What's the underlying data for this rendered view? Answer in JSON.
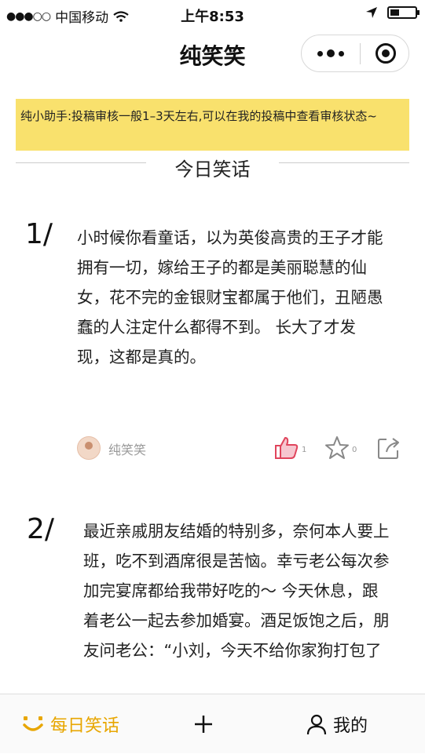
{
  "status_bar": {
    "carrier": "中国移动",
    "time": "上午8:53"
  },
  "nav": {
    "title": "纯笑笑"
  },
  "notice": {
    "text": "纯小助手:投稿审核一般1–3天左右,可以在我的投稿中查看审核状态~"
  },
  "section": {
    "title": "今日笑话"
  },
  "posts": [
    {
      "number": "1/",
      "text": "小时候你看童话，以为英俊高贵的王子才能拥有一切，嫁给王子的都是美丽聪慧的仙女，花不完的金银财宝都属于他们，丑陋愚蠢的人注定什么都得不到。 长大了才发现，这都是真的。",
      "author": "纯笑笑",
      "likes": "1",
      "favorites": "0"
    },
    {
      "number": "2/",
      "text": "最近亲戚朋友结婚的特别多，奈何本人要上班，吃不到酒席很是苦恼。幸亏老公每次参加完宴席都给我带好吃的～ 今天休息，跟着老公一起去参加婚宴。酒足饭饱之后，朋友问老公：“小刘，今天不给你家狗打包了"
    }
  ],
  "tabbar": {
    "items": [
      {
        "label": "每日笑话",
        "icon": "smile-icon",
        "active": true
      },
      {
        "label": "",
        "icon": "plus-icon",
        "active": false
      },
      {
        "label": "我的",
        "icon": "user-icon",
        "active": false
      }
    ]
  },
  "colors": {
    "notice_bg": "#f9e16d",
    "accent": "#e8a600",
    "like": "#e0445c"
  }
}
